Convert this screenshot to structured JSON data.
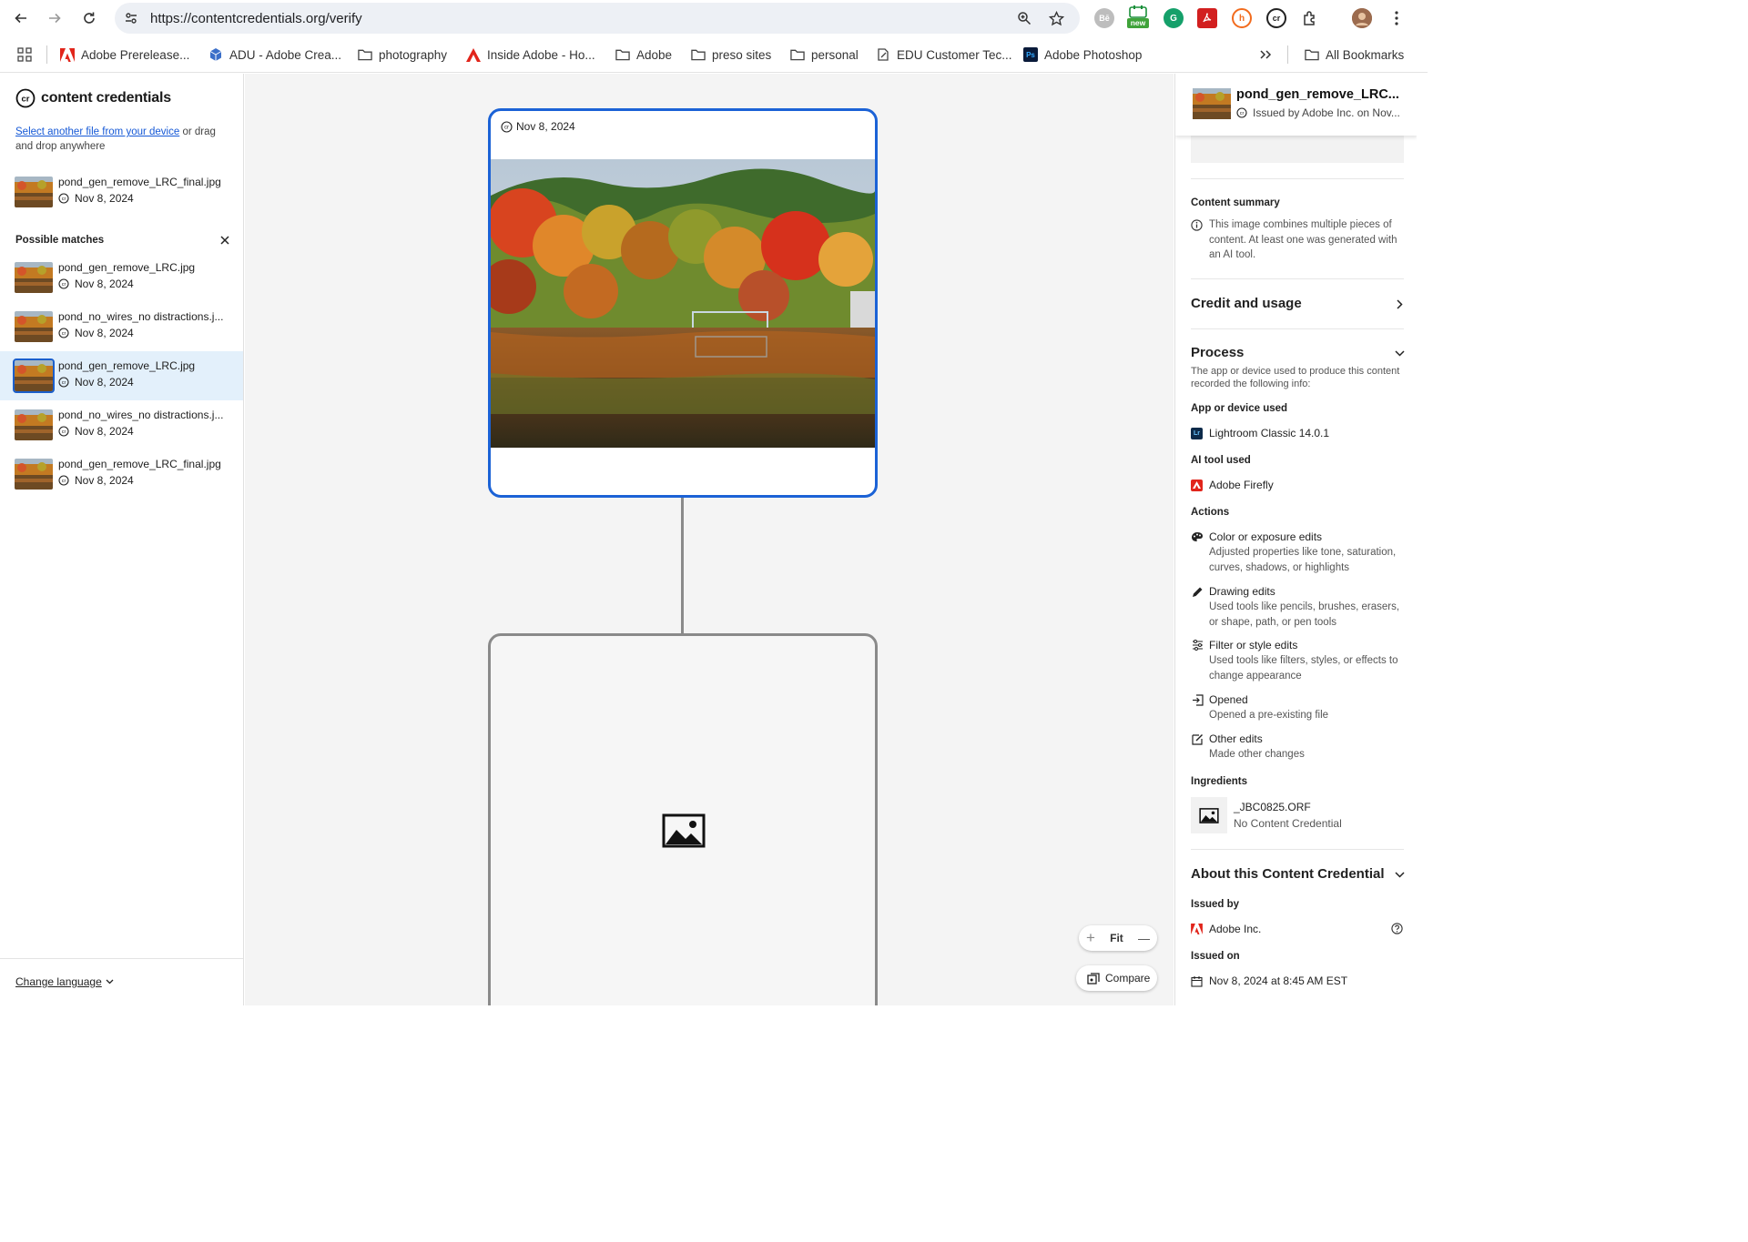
{
  "browser": {
    "url": "https://contentcredentials.org/verify",
    "bookmarks": [
      {
        "label": "Adobe Prerelease...",
        "icon": "adobe-icon"
      },
      {
        "label": "ADU - Adobe Crea...",
        "icon": "cube-icon"
      },
      {
        "label": "photography",
        "icon": "folder-icon"
      },
      {
        "label": "Inside Adobe - Ho...",
        "icon": "adobe-icon"
      },
      {
        "label": "Adobe",
        "icon": "folder-icon"
      },
      {
        "label": "preso sites",
        "icon": "folder-icon"
      },
      {
        "label": "personal",
        "icon": "folder-icon"
      },
      {
        "label": "EDU Customer Tec...",
        "icon": "edit-doc-icon"
      },
      {
        "label": "Adobe Photoshop",
        "icon": "photoshop-icon"
      }
    ],
    "all_bookmarks": "All Bookmarks",
    "extension_badge": "new",
    "extensions": {
      "be": "Bē",
      "cr": "cr"
    }
  },
  "sidebar": {
    "brand": "content credentials",
    "brand_icon": "cr",
    "select_link": "Select another file from your device",
    "select_rest": " or drag and drop anywhere",
    "current_file": {
      "name": "pond_gen_remove_LRC_final.jpg",
      "date": "Nov 8, 2024"
    },
    "possible_matches_title": "Possible matches",
    "matches": [
      {
        "name": "pond_gen_remove_LRC.jpg",
        "date": "Nov 8, 2024"
      },
      {
        "name": "pond_no_wires_no distractions.j...",
        "date": "Nov 8, 2024"
      },
      {
        "name": "pond_gen_remove_LRC.jpg",
        "date": "Nov 8, 2024",
        "selected": true
      },
      {
        "name": "pond_no_wires_no distractions.j...",
        "date": "Nov 8, 2024"
      },
      {
        "name": "pond_gen_remove_LRC_final.jpg",
        "date": "Nov 8, 2024"
      }
    ],
    "change_language": "Change language"
  },
  "canvas": {
    "node_date": "Nov 8, 2024",
    "zoom_fit": "Fit",
    "zoom_in": "+",
    "zoom_out": "—",
    "compare": "Compare"
  },
  "panel": {
    "title": "pond_gen_remove_LRC...",
    "issued": "Issued by Adobe Inc. on Nov...",
    "content_summary_title": "Content summary",
    "content_summary_text": "This image combines multiple pieces of content. At least one was generated with an AI tool.",
    "credit_usage": "Credit and usage",
    "process_title": "Process",
    "process_desc": "The app or device used to produce this content recorded the following info:",
    "app_title": "App or device used",
    "app_icon_text": "Lr",
    "app_value": "Lightroom Classic 14.0.1",
    "ai_title": "AI tool used",
    "ai_value": "Adobe Firefly",
    "actions_title": "Actions",
    "actions": [
      {
        "title": "Color or exposure edits",
        "desc": "Adjusted properties like tone, saturation, curves, shadows, or highlights",
        "icon": "palette-icon"
      },
      {
        "title": "Drawing edits",
        "desc": "Used tools like pencils, brushes, erasers, or shape, path, or pen tools",
        "icon": "pencil-icon"
      },
      {
        "title": "Filter or style edits",
        "desc": "Used tools like filters, styles, or effects to change appearance",
        "icon": "sliders-icon"
      },
      {
        "title": "Opened",
        "desc": "Opened a pre-existing file",
        "icon": "open-file-icon"
      },
      {
        "title": "Other edits",
        "desc": "Made other changes",
        "icon": "edit-icon"
      }
    ],
    "ingredients_title": "Ingredients",
    "ingredient_name": "_JBC0825.ORF",
    "ingredient_sub": "No Content Credential",
    "about_title": "About this Content Credential",
    "issued_by_title": "Issued by",
    "issued_by_value": "Adobe Inc.",
    "issued_on_title": "Issued on",
    "issued_on_value": "Nov 8, 2024 at 8:45 AM EST"
  },
  "colors": {
    "accent": "#1b62d6",
    "link": "#1558d6",
    "selected_row": "#e3f0fb",
    "adobe_red": "#e1251b"
  }
}
